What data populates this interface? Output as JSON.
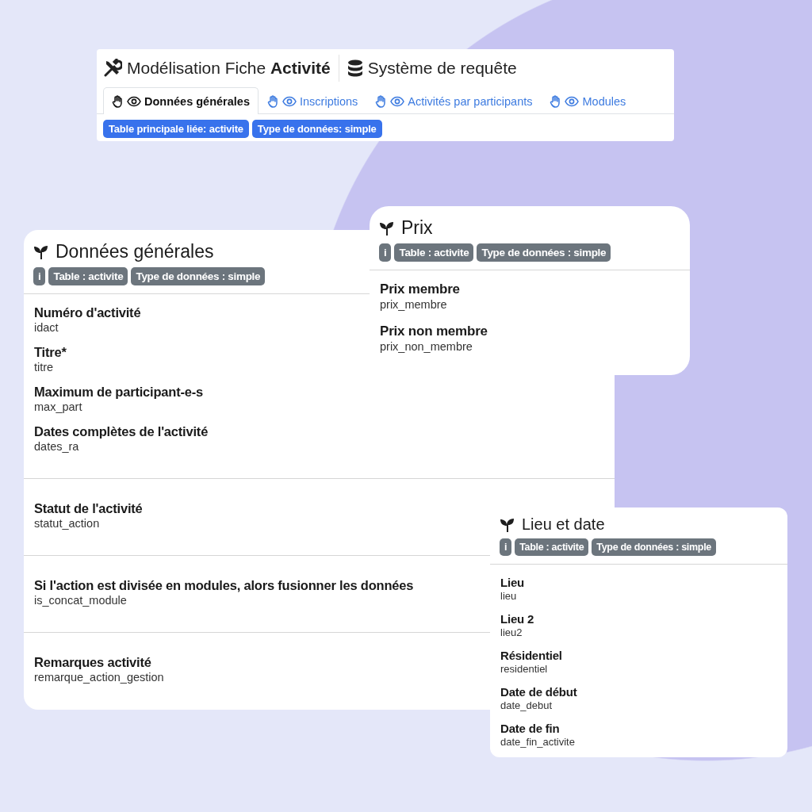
{
  "header": {
    "title": "Modélisation Fiche **Activité**",
    "second_title": "Système de requête",
    "tabs": [
      {
        "label": "Données générales",
        "selected": true
      },
      {
        "label": "Inscriptions",
        "selected": false
      },
      {
        "label": "Activités par participants",
        "selected": false
      },
      {
        "label": "Modules",
        "selected": false
      }
    ],
    "badges": [
      "Table principale liée: activite",
      "Type de données: simple"
    ]
  },
  "cards": [
    {
      "title": "Données générales",
      "info": "i",
      "badges": [
        "Table : activite",
        "Type de données : simple"
      ],
      "groups": [
        [
          {
            "label": "Numéro d'activité",
            "field": "idact"
          },
          {
            "label": "Titre*",
            "field": "titre"
          },
          {
            "label": "Maximum de participant-e-s",
            "field": "max_part"
          },
          {
            "label": "Dates complètes de l'activité",
            "field": "dates_ra"
          }
        ],
        [
          {
            "label": "Statut de l'activité",
            "field": "statut_action"
          }
        ],
        [
          {
            "label": "Si l'action est divisée en modules, alors fusionner les données",
            "field": "is_concat_module"
          }
        ],
        [
          {
            "label": "Remarques activité",
            "field": "remarque_action_gestion"
          }
        ]
      ]
    },
    {
      "title": "Prix",
      "info": "i",
      "badges": [
        "Table : activite",
        "Type de données : simple"
      ],
      "groups": [
        [
          {
            "label": "Prix membre",
            "field": "prix_membre"
          },
          {
            "label": "Prix non membre",
            "field": "prix_non_membre"
          }
        ]
      ]
    },
    {
      "title": "Lieu et date",
      "info": "i",
      "badges": [
        "Table : activite",
        "Type de données : simple"
      ],
      "groups": [
        [
          {
            "label": "Lieu",
            "field": "lieu"
          },
          {
            "label": "Lieu 2",
            "field": "lieu2"
          },
          {
            "label": "Résidentiel",
            "field": "residentiel"
          },
          {
            "label": "Date de début",
            "field": "date_debut"
          },
          {
            "label": "Date de fin",
            "field": "date_fin_activite"
          }
        ]
      ]
    }
  ]
}
